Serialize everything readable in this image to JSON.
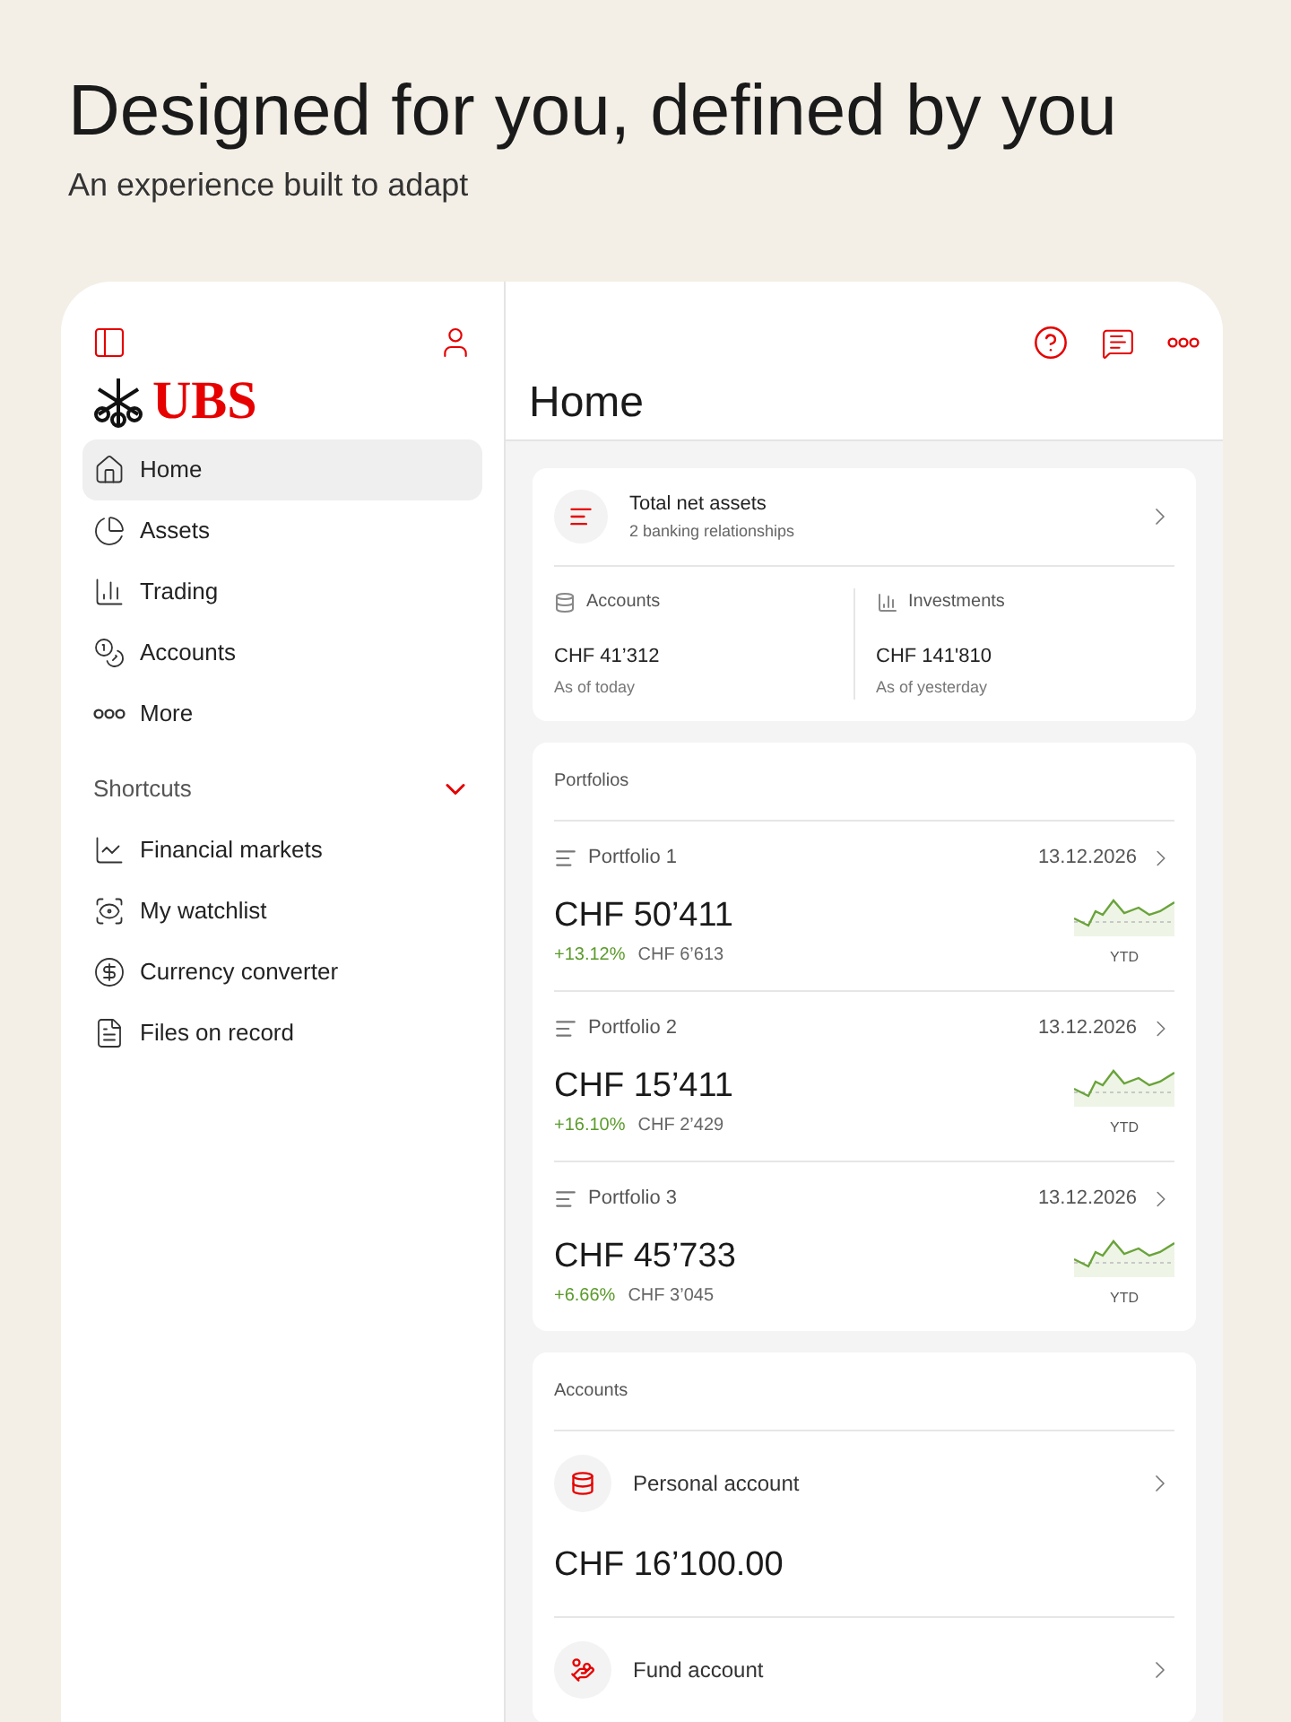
{
  "headline": {
    "title": "Designed for you, defined by you",
    "subtitle": "An experience built to adapt"
  },
  "sidebar": {
    "logo": "UBS",
    "nav_items": [
      {
        "label": "Home",
        "selected": true
      },
      {
        "label": "Assets",
        "selected": false
      },
      {
        "label": "Trading",
        "selected": false
      },
      {
        "label": "Accounts",
        "selected": false
      },
      {
        "label": "More",
        "selected": false
      }
    ],
    "shortcuts": {
      "title": "Shortcuts",
      "expanded": true,
      "items": [
        {
          "label": "Financial markets"
        },
        {
          "label": "My watchlist"
        },
        {
          "label": "Currency converter"
        },
        {
          "label": "Files on record"
        }
      ]
    }
  },
  "main": {
    "title": "Home",
    "net_assets": {
      "title": "Total net assets",
      "subtitle": "2 banking relationships",
      "columns": [
        {
          "label": "Accounts",
          "amount": "CHF 41’312",
          "note": "As of today"
        },
        {
          "label": "Investments",
          "amount": "CHF 141'810",
          "note": "As of yesterday"
        }
      ]
    },
    "portfolios": {
      "title": "Portfolios",
      "items": [
        {
          "name": "Portfolio 1",
          "date": "13.12.2026",
          "value": "CHF 50’411",
          "change": "+13.12%",
          "gain": "CHF 6’613",
          "period": "YTD"
        },
        {
          "name": "Portfolio 2",
          "date": "13.12.2026",
          "value": "CHF 15’411",
          "change": "+16.10%",
          "gain": "CHF 2’429",
          "period": "YTD"
        },
        {
          "name": "Portfolio 3",
          "date": "13.12.2026",
          "value": "CHF 45’733",
          "change": "+6.66%",
          "gain": "CHF 3’045",
          "period": "YTD"
        }
      ]
    },
    "accounts": {
      "title": "Accounts",
      "items": [
        {
          "kind": "personal",
          "name": "Personal account",
          "balance": "CHF 16’100.00"
        },
        {
          "kind": "fund",
          "name": "Fund account"
        }
      ]
    }
  }
}
